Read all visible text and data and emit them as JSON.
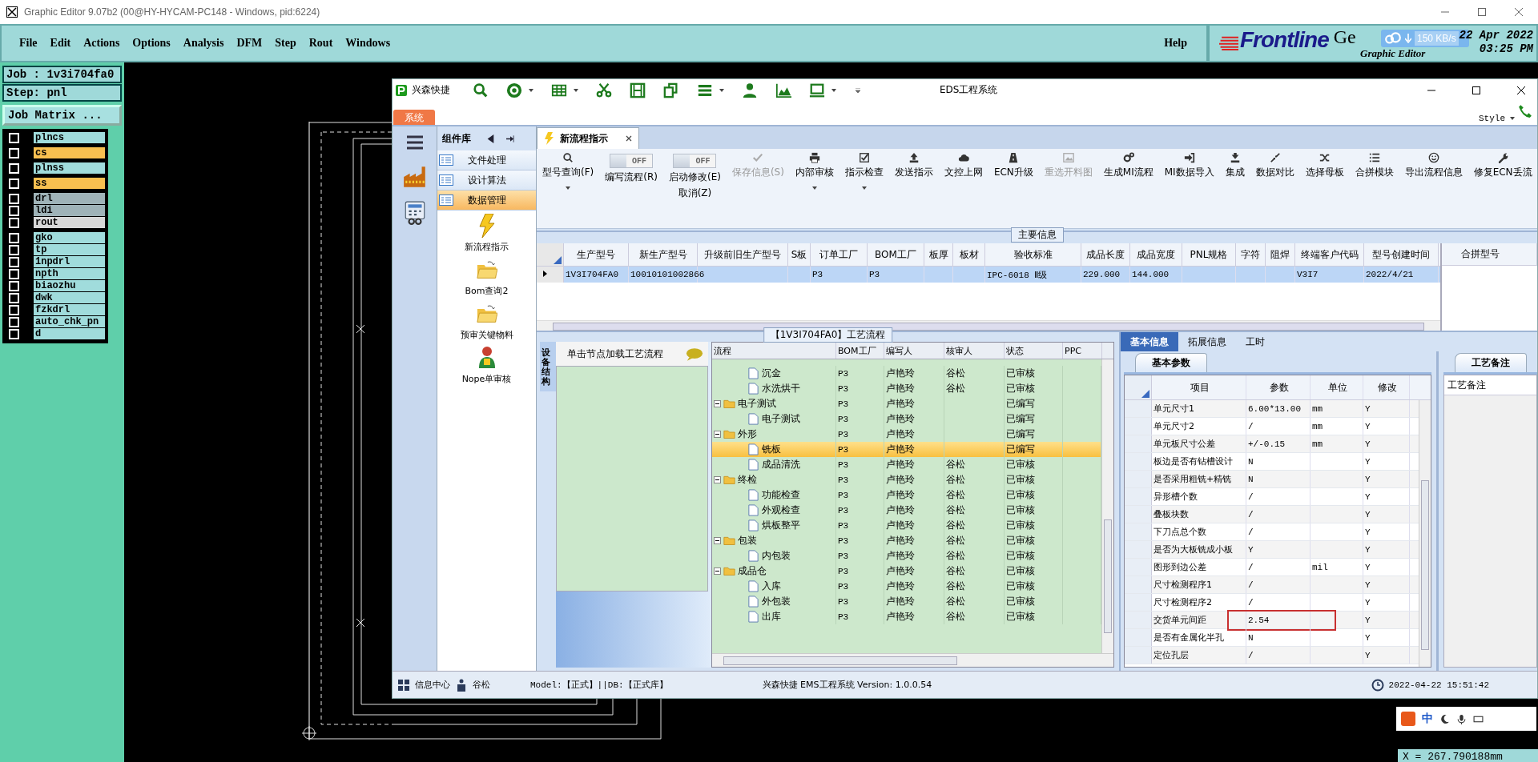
{
  "window": {
    "title": "Graphic Editor 9.07b2 (00@HY-HYCAM-PC148 - Windows, pid:6224)"
  },
  "menu": [
    "File",
    "Edit",
    "Actions",
    "Options",
    "Analysis",
    "DFM",
    "Step",
    "Rout",
    "Windows"
  ],
  "help": "Help",
  "brand": {
    "logo": "Frontline",
    "cut_text": "Ge",
    "subtitle": "Graphic Editor",
    "date": "22 Apr 2022",
    "time": "03:25 PM",
    "net_speed": "150 KB/s"
  },
  "job_panel": {
    "job": "Job : 1v3i704fa0",
    "step": "Step: pnl",
    "matrix_button": "Job Matrix ...",
    "layer_groups": [
      [
        {
          "name": "plncs",
          "color": "#a0dcdc",
          "checked": false
        }
      ],
      [
        {
          "name": "cs",
          "color": "#f8c050",
          "checked": false
        }
      ],
      [
        {
          "name": "plnss",
          "color": "#a0dcdc",
          "checked": false
        }
      ],
      [
        {
          "name": "ss",
          "color": "#f8c050",
          "checked": false
        }
      ],
      [
        {
          "name": "drl",
          "color": "#9fb3b8",
          "checked": false
        },
        {
          "name": "ldi",
          "color": "#9fb3b8",
          "checked": false
        },
        {
          "name": "rout",
          "color": "#d8d8d8",
          "checked": false
        }
      ],
      [
        {
          "name": "gko",
          "color": "#a0dcdc",
          "checked": false
        },
        {
          "name": "tp",
          "color": "#a0dcdc",
          "checked": false
        },
        {
          "name": "1npdrl",
          "color": "#a0dcdc",
          "checked": false
        },
        {
          "name": "npth",
          "color": "#a0dcdc",
          "checked": false
        },
        {
          "name": "biaozhu",
          "color": "#a0dcdc",
          "checked": false
        },
        {
          "name": "dwk",
          "color": "#a0dcdc",
          "checked": false
        },
        {
          "name": "fzkdrl",
          "color": "#a0dcdc",
          "checked": false
        },
        {
          "name": "auto_chk_pn",
          "color": "#a0dcdc",
          "checked": false
        },
        {
          "name": "d",
          "color": "#a0dcdc",
          "checked": false
        }
      ]
    ]
  },
  "coordinate": "X = 267.790188mm",
  "ime": {
    "label": "中"
  },
  "eds": {
    "app_name": "兴森快捷",
    "title": "EDS工程系统",
    "system_tab": "系统",
    "style_menu": "Style",
    "component_panel": {
      "title": "组件库",
      "categories": [
        {
          "label": "文件处理",
          "selected": false
        },
        {
          "label": "设计算法",
          "selected": false
        },
        {
          "label": "数据管理",
          "selected": true
        }
      ],
      "items": [
        "新流程指示",
        "Bom查询2",
        "预审关键物料",
        "Nope单审核"
      ]
    },
    "doc_tab": {
      "label": "新流程指示"
    },
    "ribbon": [
      {
        "kind": "button",
        "label": "型号查询(F)",
        "disabled": false,
        "dropdown": true
      },
      {
        "kind": "toggle",
        "label": "编写流程(R)",
        "switch_text": "OFF",
        "on": false
      },
      {
        "kind": "toggle",
        "label": "启动修改(E)",
        "sublabel": "取消(Z)",
        "switch_text": "OFF",
        "on": false
      },
      {
        "kind": "button",
        "label": "保存信息(S)",
        "disabled": true,
        "dropdown": false
      },
      {
        "kind": "button",
        "label": "内部审核",
        "disabled": false,
        "dropdown": true
      },
      {
        "kind": "button",
        "label": "指示检查",
        "disabled": false,
        "dropdown": true
      },
      {
        "kind": "button",
        "label": "发送指示",
        "disabled": false,
        "dropdown": false
      },
      {
        "kind": "button",
        "label": "文控上网",
        "disabled": false,
        "dropdown": false
      },
      {
        "kind": "button",
        "label": "ECN升级",
        "disabled": false,
        "dropdown": false
      },
      {
        "kind": "button",
        "label": "重选开料图",
        "disabled": true,
        "dropdown": false
      },
      {
        "kind": "button",
        "label": "生成MI流程",
        "disabled": false,
        "dropdown": false
      },
      {
        "kind": "button",
        "label": "MI数据导入",
        "disabled": false,
        "dropdown": false
      },
      {
        "kind": "button",
        "label": "集成",
        "disabled": false,
        "dropdown": false
      },
      {
        "kind": "button",
        "label": "数据对比",
        "disabled": false,
        "dropdown": false
      },
      {
        "kind": "button",
        "label": "选择母板",
        "disabled": false,
        "dropdown": false
      },
      {
        "kind": "button",
        "label": "合拼模块",
        "disabled": false,
        "dropdown": false
      },
      {
        "kind": "button",
        "label": "导出流程信息",
        "disabled": false,
        "dropdown": false
      },
      {
        "kind": "button",
        "label": "修复ECN丢流",
        "disabled": false,
        "dropdown": false
      }
    ],
    "main_info": {
      "title": "主要信息",
      "columns": [
        "生产型号",
        "新生产型号",
        "升级前旧生产型号",
        "S板",
        "订单工厂",
        "BOM工厂",
        "板厚",
        "板材",
        "验收标准",
        "成品长度",
        "成品宽度",
        "PNL规格",
        "字符",
        "阻焊",
        "终端客户代码",
        "型号创建时间"
      ],
      "rows": [
        {
          "selected": true,
          "cells": [
            "1V3I704FA0",
            "10010101002866",
            null,
            null,
            "P3",
            "P3",
            null,
            null,
            "IPC-6018 Ⅱ级",
            "229.000",
            "144.000",
            null,
            null,
            null,
            "V3I7",
            "2022/4/21"
          ]
        }
      ],
      "side_column": "合拼型号"
    },
    "process_flow": {
      "title": "【1V3I704FA0】工艺流程",
      "side_tab": "设备结构",
      "hint": "单击节点加载工艺流程",
      "columns": [
        "流程",
        "BOM工厂",
        "编写人",
        "核审人",
        "状态",
        "PPC"
      ],
      "rows": [
        {
          "kind": "file",
          "label": "沉金",
          "bom": "P3",
          "writer": "卢艳玲",
          "reviewer": "谷松",
          "status": "已审核",
          "selected": false
        },
        {
          "kind": "file",
          "label": "水洗烘干",
          "bom": "P3",
          "writer": "卢艳玲",
          "reviewer": "谷松",
          "status": "已审核",
          "selected": false
        },
        {
          "kind": "folder",
          "label": "电子测试",
          "bom": "P3",
          "writer": "卢艳玲",
          "status": "已编写",
          "selected": false,
          "children": [
            {
              "kind": "file",
              "label": "电子测试",
              "bom": "P3",
              "writer": "卢艳玲",
              "status": "已编写",
              "selected": false
            }
          ]
        },
        {
          "kind": "folder",
          "label": "外形",
          "bom": "P3",
          "writer": "卢艳玲",
          "status": "已编写",
          "selected": false,
          "children": [
            {
              "kind": "file",
              "label": "铣板",
              "bom": "P3",
              "writer": "卢艳玲",
              "status": "已编写",
              "selected": true
            },
            {
              "kind": "file",
              "label": "成品清洗",
              "bom": "P3",
              "writer": "卢艳玲",
              "reviewer": "谷松",
              "status": "已审核",
              "selected": false
            }
          ]
        },
        {
          "kind": "folder",
          "label": "终检",
          "bom": "P3",
          "writer": "卢艳玲",
          "reviewer": "谷松",
          "status": "已审核",
          "selected": false,
          "children": [
            {
              "kind": "file",
              "label": "功能检查",
              "bom": "P3",
              "writer": "卢艳玲",
              "reviewer": "谷松",
              "status": "已审核",
              "selected": false
            },
            {
              "kind": "file",
              "label": "外观检查",
              "bom": "P3",
              "writer": "卢艳玲",
              "reviewer": "谷松",
              "status": "已审核",
              "selected": false
            },
            {
              "kind": "file",
              "label": "烘板整平",
              "bom": "P3",
              "writer": "卢艳玲",
              "reviewer": "谷松",
              "status": "已审核",
              "selected": false
            }
          ]
        },
        {
          "kind": "folder",
          "label": "包装",
          "bom": "P3",
          "writer": "卢艳玲",
          "reviewer": "谷松",
          "status": "已审核",
          "selected": false,
          "children": [
            {
              "kind": "file",
              "label": "内包装",
              "bom": "P3",
              "writer": "卢艳玲",
              "reviewer": "谷松",
              "status": "已审核",
              "selected": false
            }
          ]
        },
        {
          "kind": "folder",
          "label": "成品仓",
          "bom": "P3",
          "writer": "卢艳玲",
          "reviewer": "谷松",
          "status": "已审核",
          "selected": false,
          "children": [
            {
              "kind": "file",
              "label": "入库",
              "bom": "P3",
              "writer": "卢艳玲",
              "reviewer": "谷松",
              "status": "已审核",
              "selected": false
            },
            {
              "kind": "file",
              "label": "外包装",
              "bom": "P3",
              "writer": "卢艳玲",
              "reviewer": "谷松",
              "status": "已审核",
              "selected": false
            },
            {
              "kind": "file",
              "label": "出库",
              "bom": "P3",
              "writer": "卢艳玲",
              "reviewer": "谷松",
              "status": "已审核",
              "selected": false
            }
          ]
        }
      ]
    },
    "details": {
      "tabs": [
        {
          "label": "基本信息",
          "selected": true
        },
        {
          "label": "拓展信息",
          "selected": false
        },
        {
          "label": "工时",
          "selected": false
        }
      ],
      "section_tab": "基本参数",
      "columns": [
        "项目",
        "参数",
        "单位",
        "修改"
      ],
      "rows": [
        {
          "item": "单元尺寸1",
          "value": "6.00*13.00",
          "unit": "mm",
          "modify": "Y",
          "highlighted": false
        },
        {
          "item": "单元尺寸2",
          "value": "/",
          "unit": "mm",
          "modify": "Y",
          "highlighted": false
        },
        {
          "item": "单元板尺寸公差",
          "value": "+/-0.15",
          "unit": "mm",
          "modify": "Y",
          "highlighted": false
        },
        {
          "item": "板边是否有钻槽设计",
          "value": "N",
          "modify": "Y",
          "highlighted": false
        },
        {
          "item": "是否采用粗铣+精铣",
          "value": "N",
          "modify": "Y",
          "highlighted": false
        },
        {
          "item": "异形槽个数",
          "value": "/",
          "modify": "Y",
          "highlighted": false
        },
        {
          "item": "叠板块数",
          "value": "/",
          "modify": "Y",
          "highlighted": false
        },
        {
          "item": "下刀点总个数",
          "value": "/",
          "modify": "Y",
          "highlighted": false
        },
        {
          "item": "是否为大板铣成小板",
          "value": "Y",
          "modify": "Y",
          "highlighted": false
        },
        {
          "item": "图形到边公差",
          "value": "/",
          "unit": "mil",
          "modify": "Y",
          "highlighted": false
        },
        {
          "item": "尺寸检测程序1",
          "value": "/",
          "modify": "Y",
          "highlighted": false
        },
        {
          "item": "尺寸检测程序2",
          "value": "/",
          "modify": "Y",
          "highlighted": false
        },
        {
          "item": "交货单元间距",
          "value": "2.54",
          "modify": "Y",
          "highlighted": true
        },
        {
          "item": "是否有金属化半孔",
          "value": "N",
          "modify": "Y",
          "highlighted": false
        },
        {
          "item": "定位孔层",
          "value": "/",
          "modify": "Y",
          "highlighted": false
        }
      ],
      "notes_tab": "工艺备注",
      "notes_header": "工艺备注"
    },
    "status_bar": {
      "info_center": "信息中心",
      "user": "谷松",
      "model": "Model:【正式】||DB:【正式库】",
      "version": "兴森快捷 EMS工程系统 Version: 1.0.0.54",
      "datetime": "2022-04-22 15:51:42"
    }
  }
}
